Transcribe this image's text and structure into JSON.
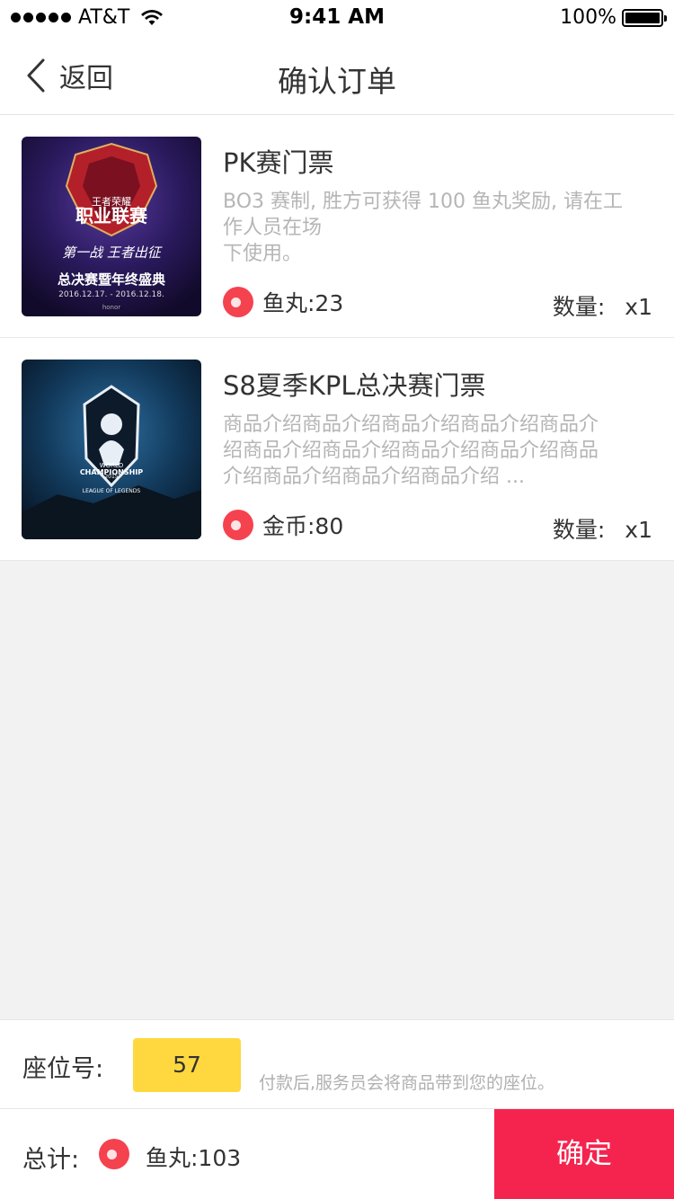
{
  "status_bar": {
    "carrier": "AT&T",
    "time": "9:41 AM",
    "battery": "100%"
  },
  "nav": {
    "back_label": "返回",
    "title": "确认订单"
  },
  "products": [
    {
      "name": "PK赛门票",
      "desc_lines": [
        "BO3 赛制, 胜方可获得 100 鱼丸奖励, 请在工",
        "作人员在场",
        "下使用。"
      ],
      "price_label": "鱼丸:23",
      "qty_label": "数量:",
      "qty_value": "x1",
      "image_text": {
        "top": "王者荣耀",
        "title": "职业联赛",
        "line1": "第一战 王者出征",
        "line2": "总决赛暨年终盛典",
        "dates": "2016.12.17. - 2016.12.18.",
        "brand": "honor"
      }
    },
    {
      "name": "S8夏季KPL总决赛门票",
      "desc_lines": [
        "商品介绍商品介绍商品介绍商品介绍商品介",
        "绍商品介绍商品介绍商品介绍商品介绍商品",
        "介绍商品介绍商品介绍商品介绍 ..."
      ],
      "price_label": "金币:80",
      "qty_label": "数量:",
      "qty_value": "x1",
      "image_text": {
        "year": "2015",
        "world": "WORLD",
        "title": "CHAMPIONSHIP",
        "sub": "LEAGUE OF LEGENDS"
      }
    }
  ],
  "seat": {
    "label": "座位号:",
    "value": "57",
    "hint": "付款后,服务员会将商品带到您的座位。"
  },
  "total": {
    "label": "总计:",
    "value": "鱼丸:103",
    "confirm_label": "确定"
  },
  "colors": {
    "accent": "#f5244f",
    "seat_highlight": "#ffd840",
    "coin": "#f5424f"
  }
}
